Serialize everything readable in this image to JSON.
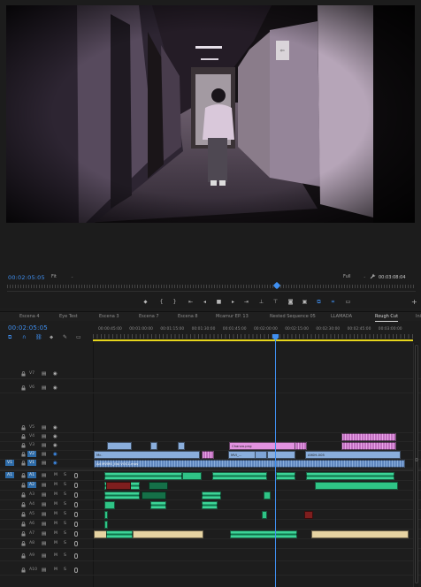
{
  "monitor": {
    "left_timecode": "00:02:05:05",
    "fit_label": "Fit",
    "quality_label": "Full",
    "duration_timecode": "00:03:08:04",
    "transport_buttons": [
      {
        "name": "add-marker-icon",
        "glyph": "⬥"
      },
      {
        "name": "mark-in-icon",
        "glyph": "{"
      },
      {
        "name": "mark-out-icon",
        "glyph": "}"
      },
      {
        "name": "go-to-in-icon",
        "glyph": "⇤"
      },
      {
        "name": "step-back-icon",
        "glyph": "◂"
      },
      {
        "name": "stop-icon",
        "glyph": "■"
      },
      {
        "name": "step-forward-icon",
        "glyph": "▸"
      },
      {
        "name": "go-to-out-icon",
        "glyph": "⇥"
      },
      {
        "name": "lift-icon",
        "glyph": "⊥"
      },
      {
        "name": "extract-icon",
        "glyph": "⊤"
      },
      {
        "name": "export-frame-icon",
        "glyph": "◙"
      },
      {
        "name": "comparison-view-icon",
        "glyph": "▣"
      },
      {
        "name": "multicam-icon",
        "glyph": "⧉"
      },
      {
        "name": "safe-margins-icon",
        "glyph": "⌗"
      },
      {
        "name": "proxy-toggle-icon",
        "glyph": "▭"
      }
    ],
    "add_button": "+"
  },
  "sequence_tabs": [
    "Escena 4",
    "Eye Test",
    "Escena 3",
    "Escena 7",
    "Escena 8",
    "Mcamur EP. 13",
    "Nested Sequence 05",
    "LLAMADA",
    "Rough Cut",
    "Ini"
  ],
  "active_tab": "Rough Cut",
  "timeline": {
    "timecode": "00:02:05:05",
    "ruler_labels": [
      "00:00:45:00",
      "00:01:00:00",
      "00:01:15:00",
      "00:01:30:00",
      "00:01:45:00",
      "00:02:00:00",
      "00:02:15:00",
      "00:02:30:00",
      "00:02:45:00",
      "00:03:00:00"
    ],
    "video_tracks": [
      "V7",
      "V6",
      "V5",
      "V4",
      "V3",
      "V2",
      "V1"
    ],
    "audio_tracks": [
      "A1",
      "A2",
      "A3",
      "A4",
      "A5",
      "A6",
      "A7",
      "A8",
      "A9",
      "A10"
    ],
    "source_patch_video": "V1",
    "source_patch_audio": "A1",
    "track_toggle_m": "M",
    "track_toggle_s": "S",
    "clip_labels": {
      "v3_title": "Chanzo.png",
      "v2_clip": "Mc.",
      "v2_clip2": "MVI_...",
      "v2_clip3": "A90H-005",
      "v1_clip": "Ad MVMO_Est VOC1.mov"
    }
  },
  "colors": {
    "accent": "#3f8ff0",
    "video_clip": "#8aaedc",
    "graphic_clip": "#e292e0",
    "audio_clip": "#2fc486",
    "work_area": "#e6d51c",
    "music_clip": "#e6d3a2"
  }
}
